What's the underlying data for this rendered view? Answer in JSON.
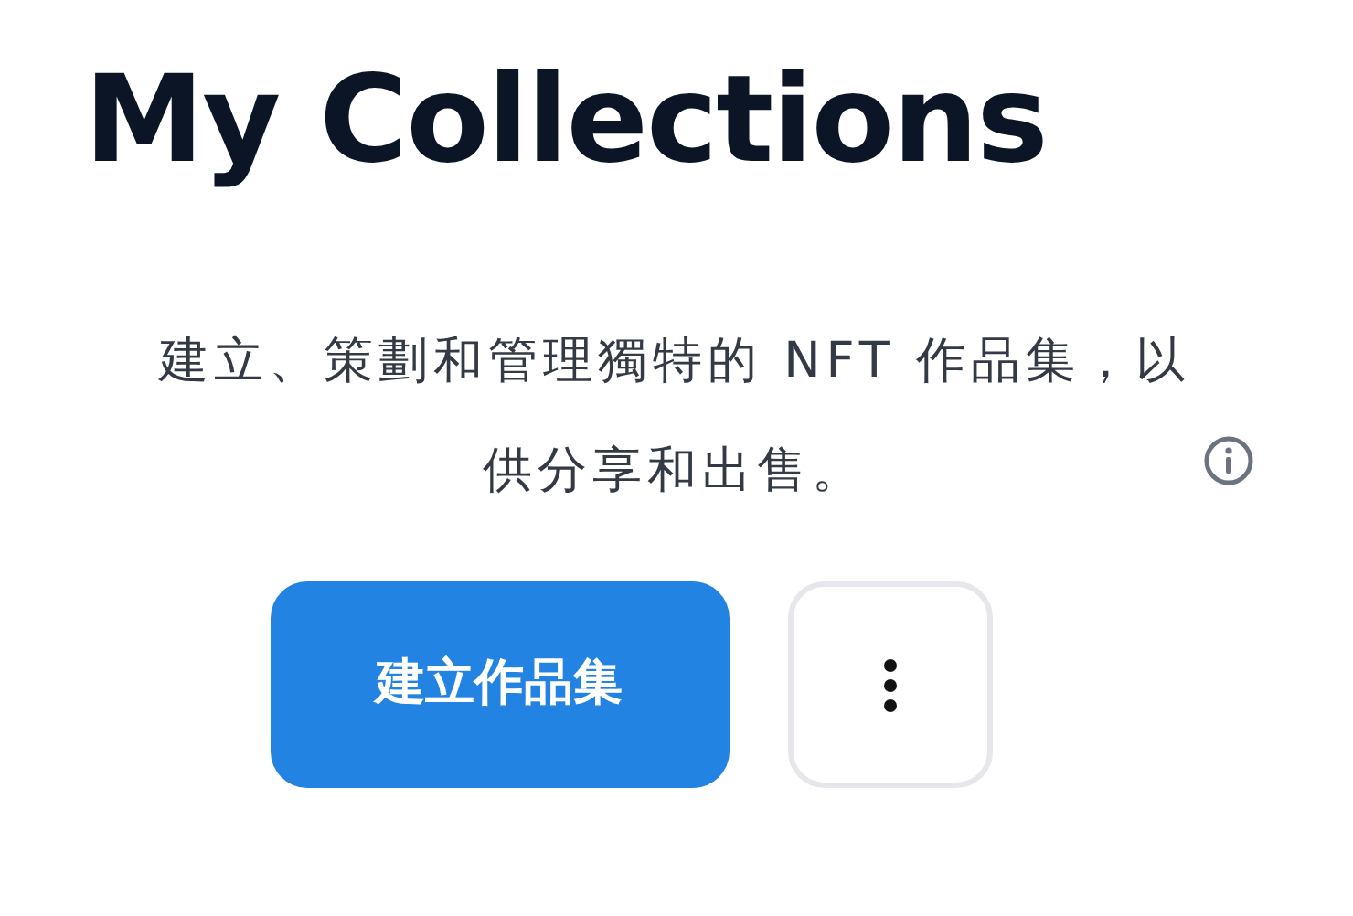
{
  "title": "My Collections",
  "description": "建立、策劃和管理獨特的 NFT 作品集，以供分享和出售。",
  "create_button": {
    "label": "建立作品集"
  }
}
